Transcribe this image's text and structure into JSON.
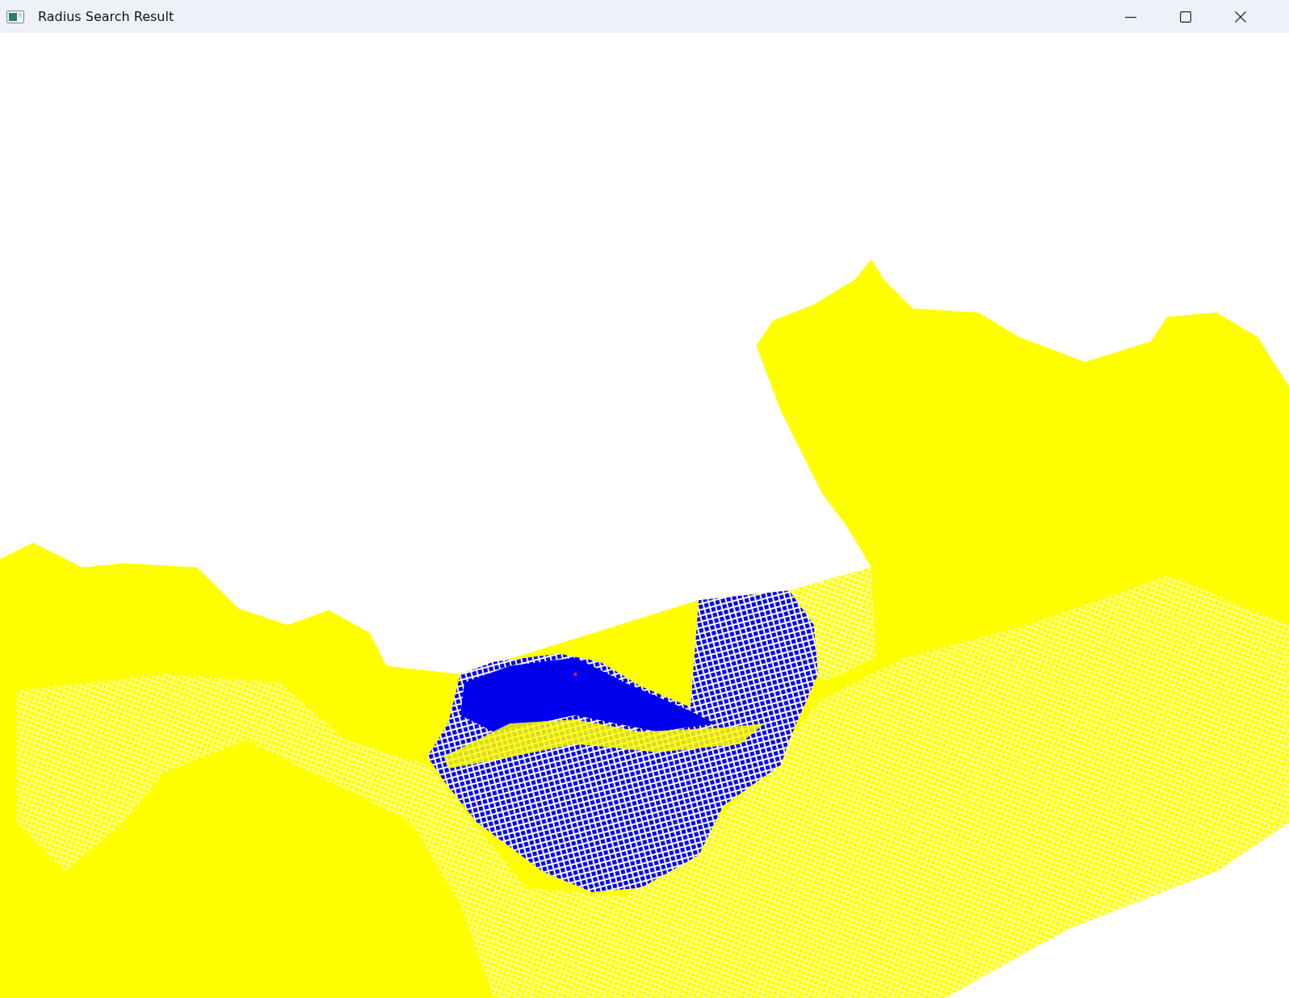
{
  "window": {
    "title": "Radius Search Result"
  }
}
